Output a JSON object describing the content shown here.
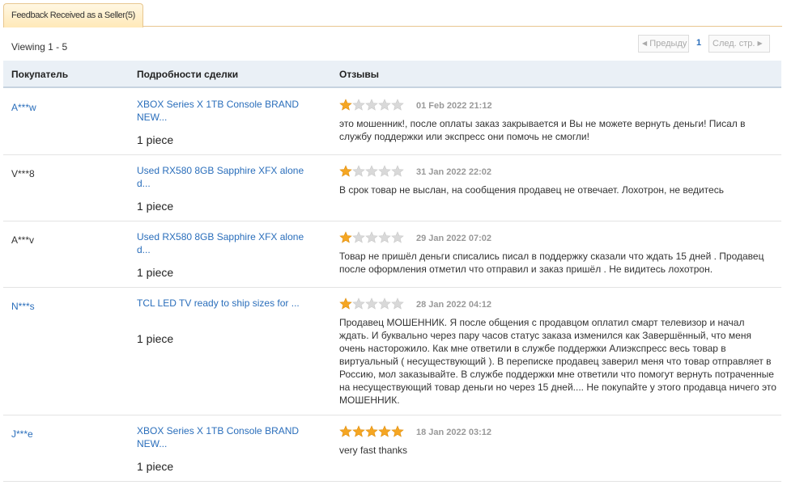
{
  "tab": {
    "label": "Feedback Received as a Seller(5)"
  },
  "viewing": "Viewing 1 - 5",
  "pager": {
    "prev": "Предыду щая",
    "current": "1",
    "next": "След. стр."
  },
  "columns": {
    "buyer": "Покупатель",
    "details": "Подробности сделки",
    "reviews": "Отзывы"
  },
  "colors": {
    "link": "#2a6ebb",
    "star_filled": "#f5a623",
    "star_empty": "#d9d9d9"
  },
  "rows": [
    {
      "buyer": "A***w",
      "buyer_link": true,
      "product": "XBOX Series X 1TB Console BRAND NEW...",
      "quantity": "1 piece",
      "rating": 1,
      "rating_display": "partial",
      "date": "01 Feb 2022 21:12",
      "comment": "это мошенник!, после оплаты заказ закрывается и Вы не можете вернуть деньги! Писал в службу поддержки или экспресс они помочь не смогли!"
    },
    {
      "buyer": "V***8",
      "buyer_link": false,
      "product": "Used RX580 8GB Sapphire XFX alone d...",
      "quantity": "1 piece",
      "rating": 1,
      "date": "31 Jan 2022 22:02",
      "comment": "В срок товар не выслан, на сообщения продавец не отвечает. Лохотрон, не ведитесь"
    },
    {
      "buyer": "A***v",
      "buyer_link": false,
      "product": "Used RX580 8GB Sapphire XFX alone d...",
      "quantity": "1 piece",
      "rating": 1,
      "date": "29 Jan 2022 07:02",
      "comment": "Товар не пришёл деньги списались писал в поддержку сказали что ждать 15 дней . Продавец после оформления отметил что отправил и заказ пришёл . Не видитесь лохотрон."
    },
    {
      "buyer": "N***s",
      "buyer_link": true,
      "product": "TCL LED TV ready to ship sizes for ...",
      "quantity": "1 piece",
      "rating": 1,
      "date": "28 Jan 2022 04:12",
      "comment": "Продавец МОШЕННИК. Я после общения с продавцом оплатил смарт телевизор и начал ждать. И буквально через пару часов статус заказа изменился как Завершённый, что меня очень насторожило. Как мне ответили в службе поддержки Алиэкспресс весь товар в виртуальный ( несуществующий ). В переписке продавец заверил меня что товар отправляет в Россию, мол заказывайте. В службе поддержки мне ответили что помогут вернуть потраченные на несуществующий товар деньги но через 15 дней.... Не покупайте у этого продавца ничего это МОШЕННИК."
    },
    {
      "buyer": "J***e",
      "buyer_link": true,
      "product": "XBOX Series X 1TB Console BRAND NEW...",
      "quantity": "1 piece",
      "rating": 5,
      "date": "18 Jan 2022 03:12",
      "comment": "very fast thanks"
    }
  ]
}
